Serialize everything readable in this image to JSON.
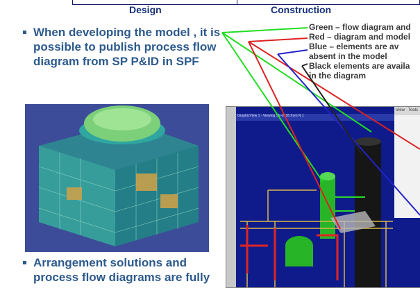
{
  "header": {
    "design_label": "Design",
    "construction_label": "Construction"
  },
  "bullets": [
    {
      "text": "When developing the model , it is possible to publish process flow diagram from SP P&ID in SPF"
    },
    {
      "text": "Arrangement solutions and process flow diagrams are fully"
    }
  ],
  "legend": {
    "line1": "Green – flow diagram and",
    "line2": "Red – diagram and model",
    "line3": "Blue – elements are av",
    "line4": "absent in the model",
    "line5": "Black elements are availa",
    "line6": "in the diagram"
  },
  "viewer": {
    "title": "GraphicView 1 - Viewing SE-0105 from N 1",
    "menu_view": "View",
    "menu_tools": "Tools"
  },
  "colors": {
    "heading": "#2d5a8e",
    "green_line": "#22dd22",
    "red_line": "#dd2222",
    "blue_line": "#2222cc",
    "black_line": "#222222"
  }
}
